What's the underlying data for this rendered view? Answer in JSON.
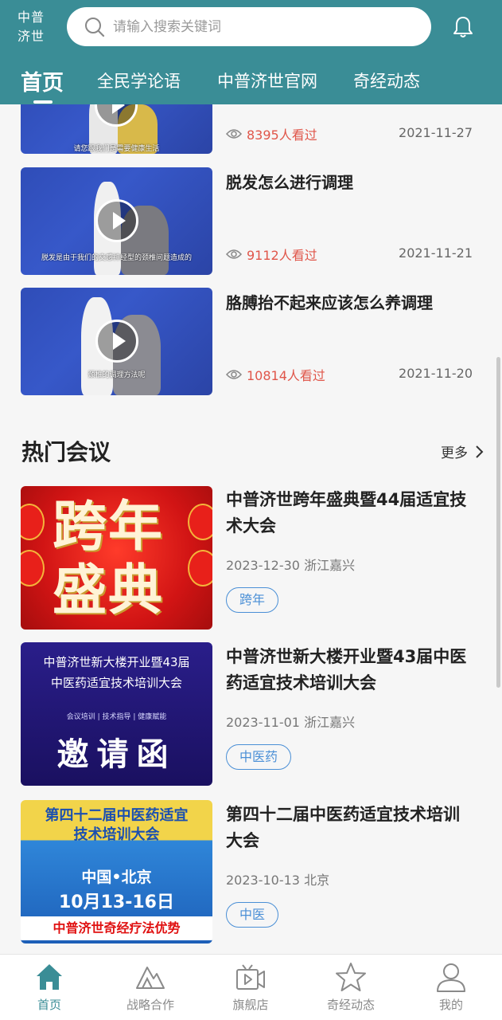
{
  "header": {
    "logo_line1": "中普",
    "logo_line2": "济世",
    "search_placeholder": "请输入搜索关键词",
    "bell_icon": "bell-icon"
  },
  "tabs": [
    {
      "label": "首页",
      "active": true
    },
    {
      "label": "全民学论语",
      "active": false
    },
    {
      "label": "中普济世官网",
      "active": false
    },
    {
      "label": "奇经动态",
      "active": false
    }
  ],
  "videos": [
    {
      "title": "",
      "views": "8395人看过",
      "date": "2021-11-27",
      "subtitle": "请您跟我们是需要健康生活"
    },
    {
      "title": "脱发怎么进行调理",
      "views": "9112人看过",
      "date": "2021-11-21",
      "subtitle": "脱发是由于我们的交感神经型的颈椎问题造成的"
    },
    {
      "title": "胳膊抬不起来应该怎么养调理",
      "views": "10814人看过",
      "date": "2021-11-20",
      "subtitle": "颈椎的调理方法呢"
    }
  ],
  "meetings_section": {
    "title": "热门会议",
    "more": "更多"
  },
  "meetings": [
    {
      "title": "中普济世跨年盛典暨44届适宜技术大会",
      "meta": "2023-12-30 浙江嘉兴",
      "tag": "跨年",
      "poster_text": "跨年盛典"
    },
    {
      "title": "中普济世新大楼开业暨43届中医药适宜技术培训大会",
      "meta": "2023-11-01 浙江嘉兴",
      "tag": "中医药",
      "poster_line1": "中普济世新大楼开业暨43届",
      "poster_line2": "中医药适宜技术培训大会",
      "poster_line3": "会议培训 | 技术指导 | 健康赋能",
      "poster_line4": "邀请函"
    },
    {
      "title": "第四十二届中医药适宜技术培训大会",
      "meta": "2023-10-13 北京",
      "tag": "中医",
      "poster_line1": "第四十二届中医药适宜",
      "poster_line2": "技术培训大会",
      "poster_line3": "中国•北京",
      "poster_line4": "10月13-16日",
      "poster_line5": "中普济世奇经疗法优势"
    }
  ],
  "bottom_nav": [
    {
      "label": "首页",
      "icon": "home-icon",
      "active": true
    },
    {
      "label": "战略合作",
      "icon": "mountain-icon",
      "active": false
    },
    {
      "label": "旗舰店",
      "icon": "video-store-icon",
      "active": false
    },
    {
      "label": "奇经动态",
      "icon": "star-icon",
      "active": false
    },
    {
      "label": "我的",
      "icon": "user-icon",
      "active": false
    }
  ],
  "colors": {
    "primary": "#3a8d96",
    "views_red": "#e0564a",
    "tag_blue": "#4a8fd6"
  }
}
